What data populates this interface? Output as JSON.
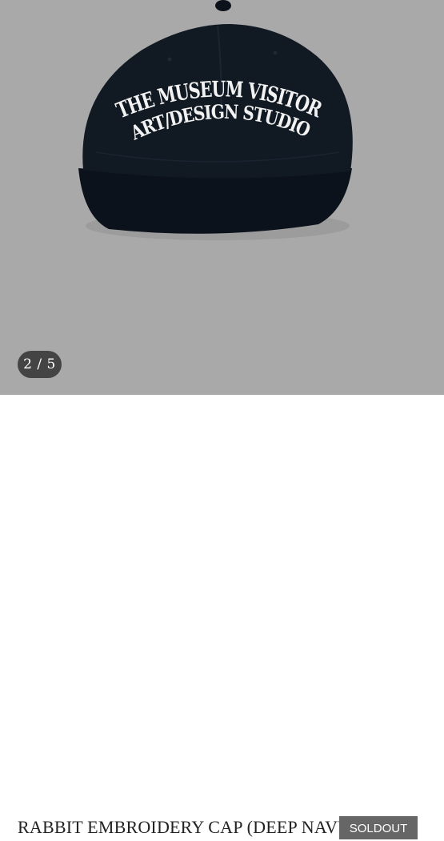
{
  "gallery": {
    "embroidery_line1": "THE MUSEUM VISITOR",
    "embroidery_line2": "ART/DESIGN STUDIO",
    "counter": "2 / 5",
    "background_color": "#a9a9a9",
    "cap_color": "#0f1620"
  },
  "product": {
    "name": "RABBIT EMBROIDERY CAP (DEEP NAVY)",
    "status_badge": "SOLDOUT"
  }
}
